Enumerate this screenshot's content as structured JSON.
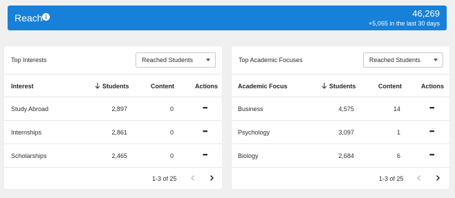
{
  "reach": {
    "title": "Reach",
    "total": "46,269",
    "delta": "+5,065 in the last 30 days"
  },
  "interests": {
    "title": "Top Interests",
    "select_value": "Reached Students",
    "columns": {
      "name": "Interest",
      "students": "Students",
      "content": "Content",
      "actions": "Actions"
    },
    "rows": [
      {
        "name": "Study Abroad",
        "students": "2,897",
        "content": "0"
      },
      {
        "name": "Internships",
        "students": "2,861",
        "content": "0"
      },
      {
        "name": "Scholarships",
        "students": "2,465",
        "content": "0"
      }
    ],
    "pager": "1-3 of 25"
  },
  "focuses": {
    "title": "Top Academic Focuses",
    "select_value": "Reached Students",
    "columns": {
      "name": "Academic Focus",
      "students": "Students",
      "content": "Content",
      "actions": "Actions"
    },
    "rows": [
      {
        "name": "Business",
        "students": "4,575",
        "content": "14"
      },
      {
        "name": "Psychology",
        "students": "3,097",
        "content": "1"
      },
      {
        "name": "Biology",
        "students": "2,684",
        "content": "6"
      }
    ],
    "pager": "1-3 of 25"
  },
  "colors": {
    "accent": "#1780d9",
    "background": "#f0f0f1"
  },
  "icons": {
    "info": "info-icon",
    "sort": "arrow-down-icon",
    "more": "more-horizontal-icon",
    "prev": "chevron-left-icon",
    "next": "chevron-right-icon",
    "dropdown": "caret-down-icon"
  }
}
